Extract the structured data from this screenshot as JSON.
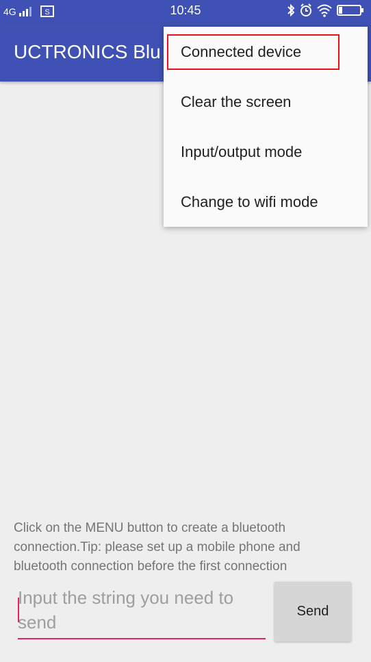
{
  "status_bar": {
    "network": "4G",
    "time": "10:45",
    "icons": [
      "signal-icon",
      "sim-icon",
      "bluetooth-icon",
      "alarm-icon",
      "wifi-icon",
      "battery-icon"
    ]
  },
  "app_bar": {
    "title": "UCTRONICS Blu"
  },
  "menu": {
    "items": [
      {
        "label": "Connected device"
      },
      {
        "label": "Clear the screen"
      },
      {
        "label": "Input/output mode"
      },
      {
        "label": "Change to wifi mode"
      }
    ],
    "highlighted_item": "Connected device",
    "highlight_color": "#e8141c"
  },
  "main": {
    "tip": "Click on the MENU button to create a bluetooth connection.Tip: please set up a mobile phone and bluetooth connection before the first connection"
  },
  "composer": {
    "input_value": "",
    "input_placeholder": "Input the string you need to send",
    "send_label": "Send"
  },
  "colors": {
    "primary": "#3f51b5",
    "accent": "#e91e63",
    "background": "#eeeeee"
  }
}
